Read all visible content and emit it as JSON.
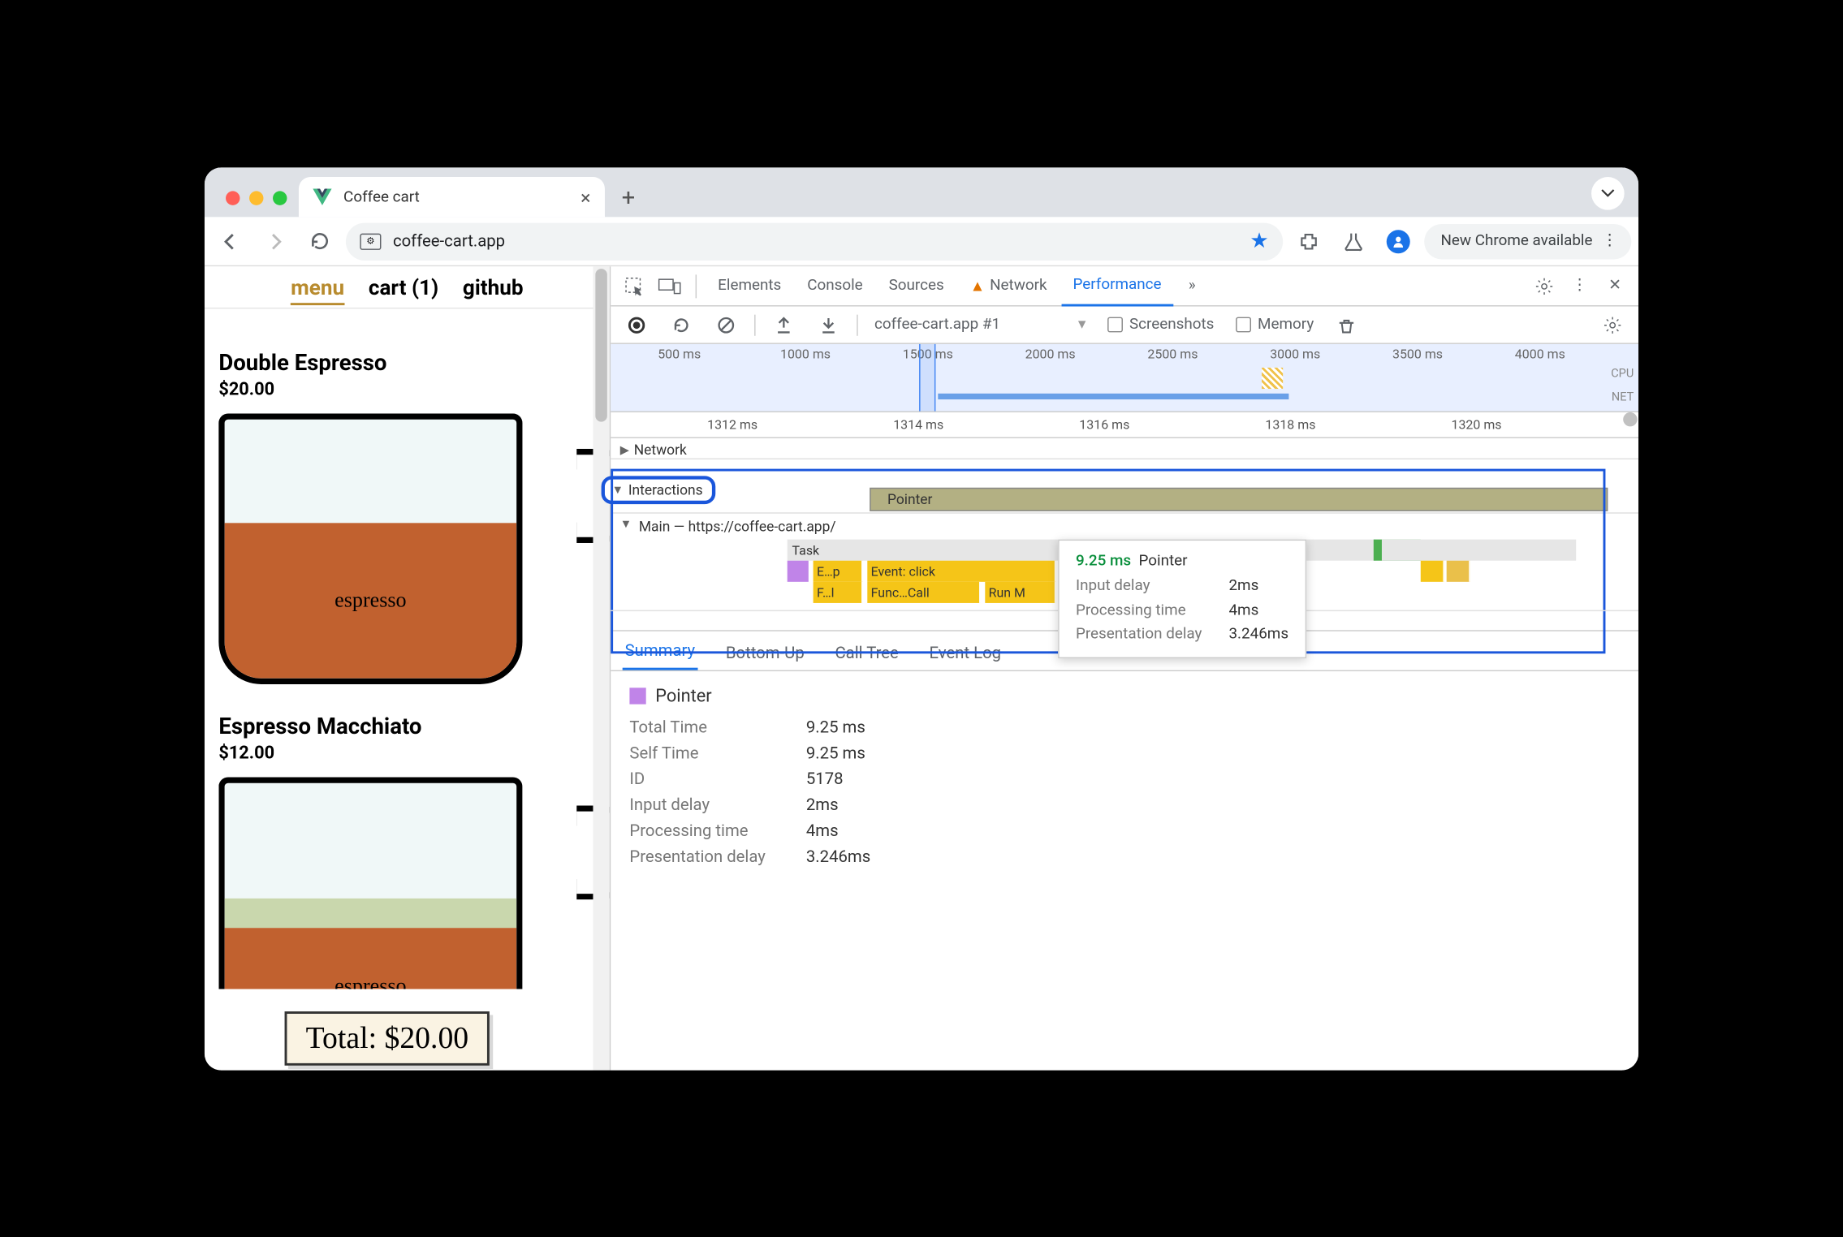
{
  "browser": {
    "tab_title": "Coffee cart",
    "url": "coffee-cart.app",
    "new_chrome": "New Chrome available"
  },
  "page": {
    "nav": {
      "menu": "menu",
      "cart": "cart (1)",
      "github": "github"
    },
    "products": [
      {
        "name": "Double Espresso",
        "price": "$20.00",
        "label": "espresso"
      },
      {
        "name": "Espresso Macchiato",
        "price": "$12.00",
        "label": "espresso"
      }
    ],
    "total": "Total: $20.00"
  },
  "devtools": {
    "tabs": {
      "elements": "Elements",
      "console": "Console",
      "sources": "Sources",
      "network": "Network",
      "performance": "Performance"
    },
    "toolbar": {
      "dropdown": "coffee-cart.app #1",
      "screenshots": "Screenshots",
      "memory": "Memory"
    },
    "overview_ticks": [
      "500 ms",
      "1000 ms",
      "1500 ms",
      "2000 ms",
      "2500 ms",
      "3000 ms",
      "3500 ms",
      "4000 ms"
    ],
    "overview_labels": {
      "cpu": "CPU",
      "net": "NET"
    },
    "ruler_ticks": [
      "1312 ms",
      "1314 ms",
      "1316 ms",
      "1318 ms",
      "1320 ms"
    ],
    "tracks": {
      "network": "Network",
      "interactions": "Interactions",
      "pointer": "Pointer",
      "main": "Main — https://coffee-cart.app/",
      "task": "Task",
      "ep": "E…p",
      "event_click": "Event: click",
      "fl": "F…l",
      "func_call": "Func…Call",
      "run": "Run M"
    },
    "tooltip": {
      "time": "9.25 ms",
      "label": "Pointer",
      "input_delay_k": "Input delay",
      "input_delay_v": "2ms",
      "proc_k": "Processing time",
      "proc_v": "4ms",
      "pres_k": "Presentation delay",
      "pres_v": "3.246ms"
    },
    "sum_tabs": {
      "summary": "Summary",
      "bottom": "Bottom-Up",
      "calltree": "Call Tree",
      "eventlog": "Event Log"
    },
    "summary": {
      "title": "Pointer",
      "rows": [
        {
          "k": "Total Time",
          "v": "9.25 ms"
        },
        {
          "k": "Self Time",
          "v": "9.25 ms"
        },
        {
          "k": "ID",
          "v": "5178"
        },
        {
          "k": "Input delay",
          "v": "2ms"
        },
        {
          "k": "Processing time",
          "v": "4ms"
        },
        {
          "k": "Presentation delay",
          "v": "3.246ms"
        }
      ]
    }
  }
}
